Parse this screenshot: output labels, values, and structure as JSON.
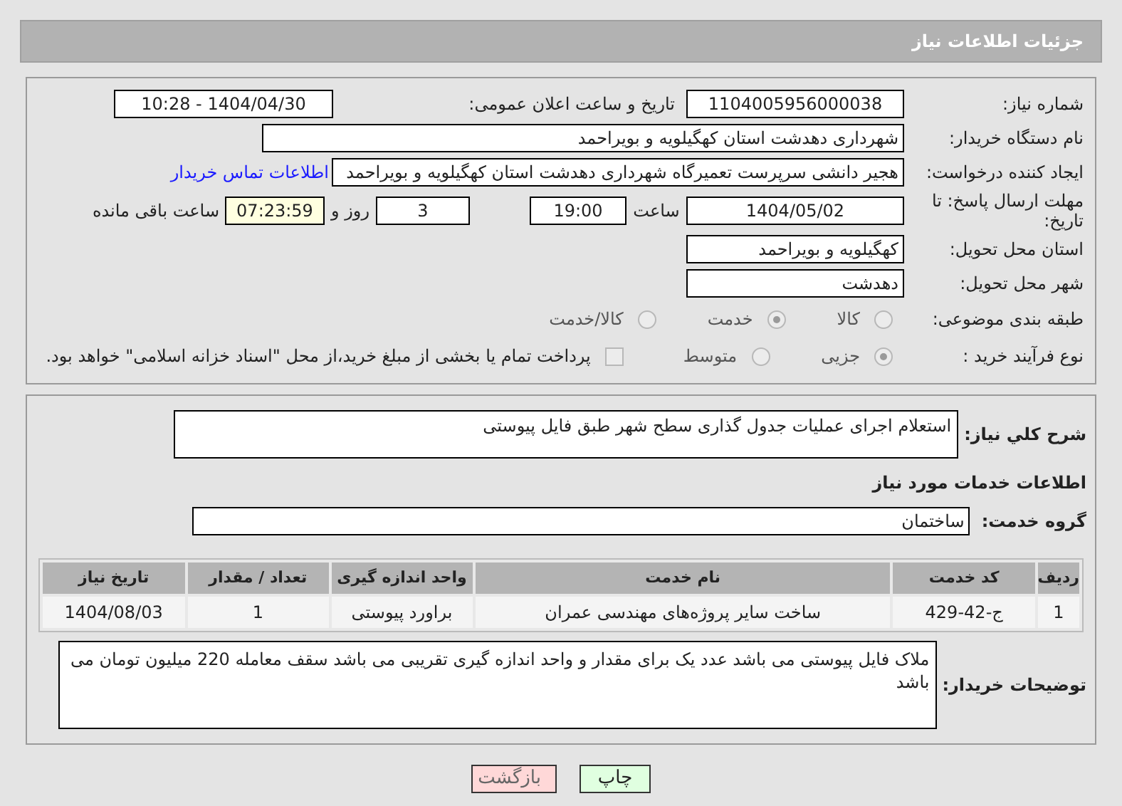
{
  "header": {
    "title": "جزئیات اطلاعات نیاز"
  },
  "need_number": {
    "label": "شماره نیاز:",
    "value": "1104005956000038"
  },
  "announce": {
    "label": "تاریخ و ساعت اعلان عمومی:",
    "value": "1404/04/30 - 10:28"
  },
  "buyer_org": {
    "label": "نام دستگاه خریدار:",
    "value": "شهرداری دهدشت استان کهگیلویه و بویراحمد"
  },
  "requester": {
    "label": "ایجاد کننده درخواست:",
    "value": "هجیر دانشی سرپرست تعمیرگاه شهرداری دهدشت استان کهگیلویه و بویراحمد",
    "link": "اطلاعات تماس خریدار"
  },
  "deadline": {
    "label": "مهلت ارسال پاسخ: تا تاریخ:",
    "date": "1404/05/02",
    "time_label": "ساعت",
    "time": "19:00",
    "days": "3",
    "days_label": "روز و",
    "remaining": "07:23:59",
    "remaining_label": "ساعت باقی مانده"
  },
  "province": {
    "label": "استان محل تحویل:",
    "value": "کهگیلویه و بویراحمد"
  },
  "city": {
    "label": "شهر محل تحویل:",
    "value": "دهدشت"
  },
  "category": {
    "label": "طبقه بندی موضوعی:",
    "options": [
      {
        "label": "کالا",
        "selected": false
      },
      {
        "label": "خدمت",
        "selected": true
      },
      {
        "label": "کالا/خدمت",
        "selected": false
      }
    ]
  },
  "process": {
    "label": "نوع فرآیند خرید :",
    "options": [
      {
        "label": "جزیی",
        "selected": true
      },
      {
        "label": "متوسط",
        "selected": false
      }
    ],
    "payment": {
      "label": "پرداخت تمام یا بخشی از مبلغ خرید،از محل \"اسناد خزانه اسلامی\" خواهد بود.",
      "checked": false
    }
  },
  "description": {
    "label": "شرح کلي نیاز:",
    "value": "استعلام اجرای عملیات جدول گذاری سطح شهر طبق فایل پیوستی"
  },
  "services_heading": "اطلاعات خدمات مورد نیاز",
  "service_group": {
    "label": "گروه خدمت:",
    "value": "ساختمان"
  },
  "table": {
    "columns": [
      "ردیف",
      "کد خدمت",
      "نام خدمت",
      "واحد اندازه گیری",
      "تعداد / مقدار",
      "تاریخ نیاز"
    ],
    "rows": [
      [
        "1",
        "ج-42-429",
        "ساخت سایر پروژه‌های مهندسی عمران",
        "براورد پیوستی",
        "1",
        "1404/08/03"
      ]
    ]
  },
  "notes": {
    "label": "توضیحات خریدار:",
    "value": "ملاک فایل پیوستی می باشد عدد یک برای مقدار و واحد اندازه گیری تقریبی می باشد سقف معامله 220 میلیون تومان می باشد"
  },
  "buttons": [
    {
      "label": "چاپ",
      "kind": "print"
    },
    {
      "label": "بازگشت",
      "kind": "back"
    }
  ]
}
